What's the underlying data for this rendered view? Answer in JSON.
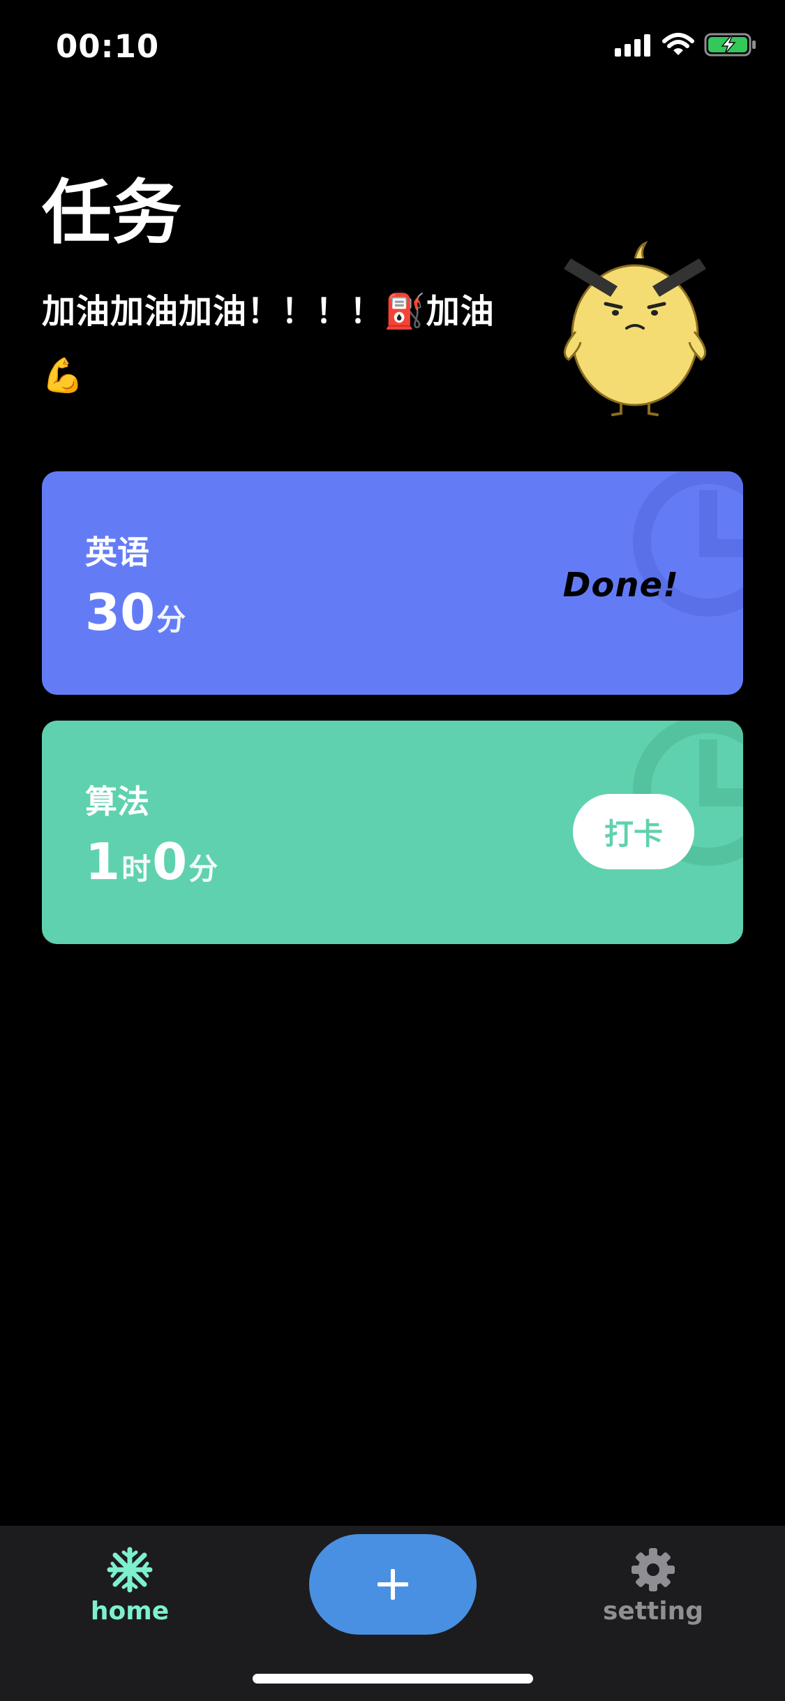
{
  "status_bar": {
    "time": "00:10"
  },
  "page": {
    "title": "任务",
    "motto_line1": "加油加油加油！！！！⛽加油",
    "motto_line2": "💪"
  },
  "tasks": [
    {
      "name": "英语",
      "duration": {
        "minutes": "30",
        "minute_unit": "分"
      },
      "status_text": "Done!",
      "color": "#637cf6"
    },
    {
      "name": "算法",
      "duration": {
        "hours": "1",
        "hour_unit": "时",
        "minutes": "0",
        "minute_unit": "分"
      },
      "button_label": "打卡",
      "color": "#5fd1ae"
    }
  ],
  "tab_bar": {
    "home_label": "home",
    "home_icon": "snowflake-icon",
    "add_icon": "plus-icon",
    "setting_label": "setting",
    "setting_icon": "gear-icon",
    "active_color": "#7ef0cf",
    "inactive_color": "#8e8e93"
  }
}
